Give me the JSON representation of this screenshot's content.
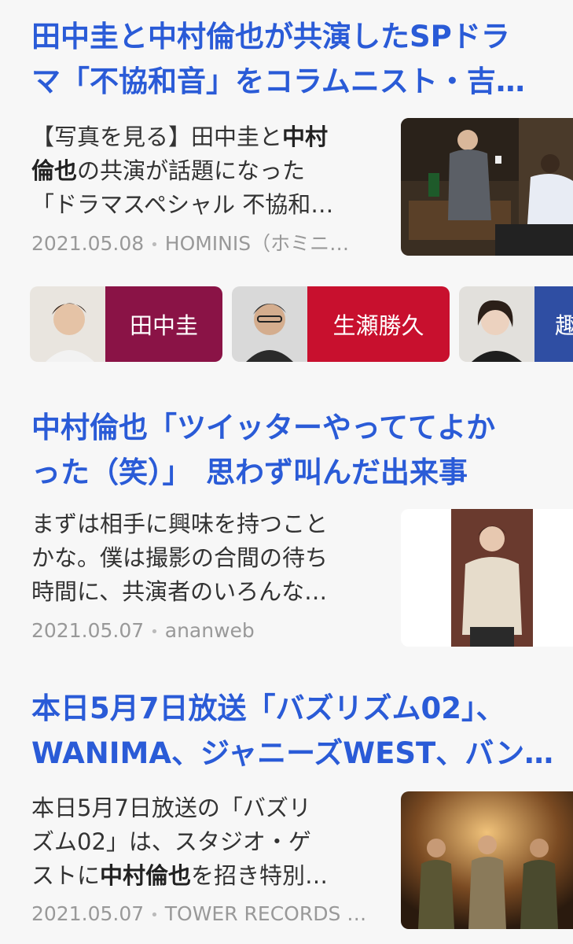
{
  "articles": [
    {
      "headline_line1": "田中圭と中村倫也が共演したSPドラ",
      "headline_line2": "マ「不協和音」をコラムニスト・吉…",
      "snippet_l1_a": "【写真を見る】田中圭と",
      "snippet_l1_b": "中村",
      "snippet_l2_a": "倫也",
      "snippet_l2_b": "の共演が話題になった",
      "snippet_l3": "「ドラマスペシャル 不協和…",
      "date": "2021.05.08",
      "source": "HOMINIS（ホミニ…"
    },
    {
      "headline_line1": "中村倫也「ツイッターやっててよか",
      "headline_line2": "った（笑）」　思わず叫んだ出来事",
      "snippet_l1": "まずは相手に興味を持つこと",
      "snippet_l2": "かな。僕は撮影の合間の待ち",
      "snippet_l3": "時間に、共演者のいろんな…",
      "date": "2021.05.07",
      "source": "ananweb"
    },
    {
      "headline_line1": "本日5月7日放送「バズリズム02」、",
      "headline_line2": "WANIMA、ジャニーズWEST、バン…",
      "snippet_l1": "本日5月7日放送の「バズリ",
      "snippet_l2": "ズム02」は、スタジオ・ゲ",
      "snippet_l3_a": "ストに",
      "snippet_l3_b": "中村倫也",
      "snippet_l3_c": "を招き特別…",
      "date": "2021.05.07",
      "source": "TOWER RECORDS …"
    }
  ],
  "tags": [
    {
      "label": "田中圭",
      "color": "#8a1346"
    },
    {
      "label": "生瀬勝久",
      "color": "#c8102e"
    },
    {
      "label": "趣",
      "color": "#2f4ea3"
    }
  ],
  "colors": {
    "headline": "#2a5bd7",
    "meta": "#999999",
    "background": "#f7f7f7"
  }
}
